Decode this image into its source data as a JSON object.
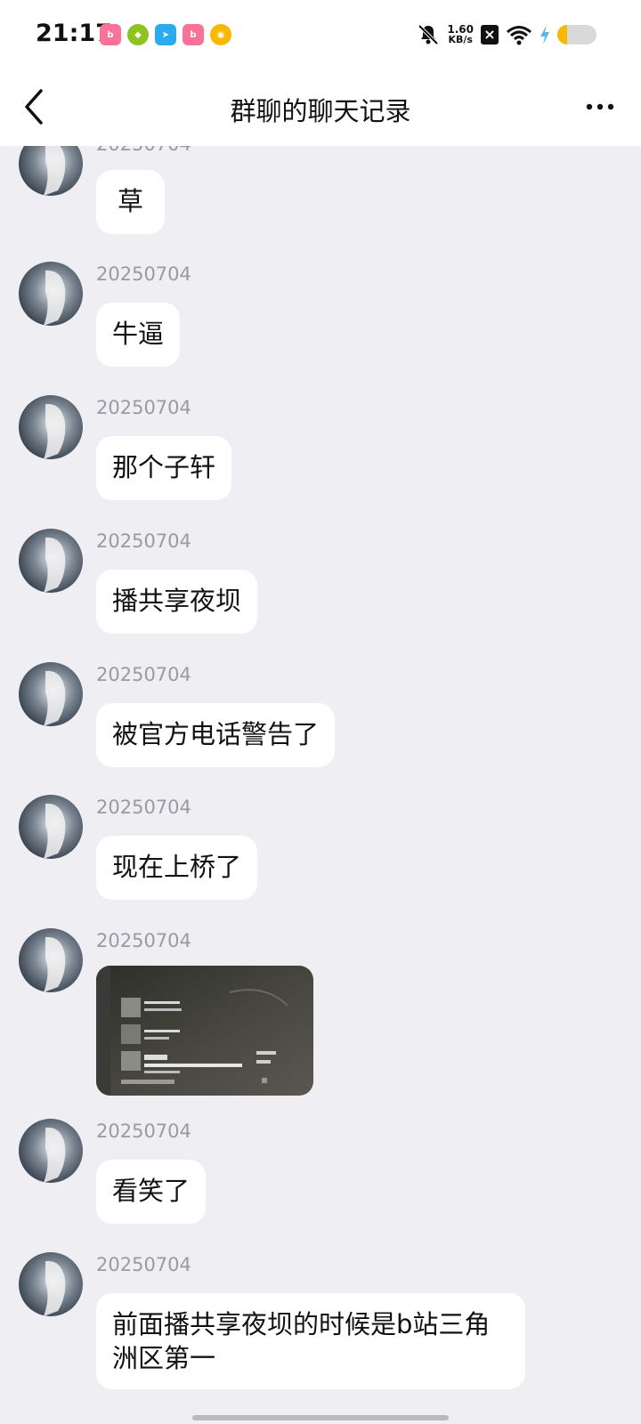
{
  "status_bar": {
    "time": "21:17",
    "net_speed_value": "1.60",
    "net_speed_unit": "KB/s",
    "battery_level": 0.25,
    "app_icons": [
      "bilibili-icon",
      "leaf-app-icon",
      "telegram-icon",
      "bilibili-icon",
      "weibo-icon"
    ],
    "colors": {
      "bilibili": "#fb7299",
      "leaf": "#8dc21f",
      "telegram": "#2aabee",
      "weibo": "#f6b800"
    }
  },
  "header": {
    "title": "群聊的聊天记录"
  },
  "messages": [
    {
      "sender": "20250704",
      "text": "草"
    },
    {
      "sender": "20250704",
      "text": "牛逼"
    },
    {
      "sender": "20250704",
      "text": "那个子轩"
    },
    {
      "sender": "20250704",
      "text": "播共享夜坝"
    },
    {
      "sender": "20250704",
      "text": "被官方电话警告了"
    },
    {
      "sender": "20250704",
      "text": "现在上桥了"
    },
    {
      "sender": "20250704",
      "type": "image"
    },
    {
      "sender": "20250704",
      "text": "看笑了"
    },
    {
      "sender": "20250704",
      "text": "前面播共享夜坝的时候是b站三角洲区第一"
    }
  ]
}
